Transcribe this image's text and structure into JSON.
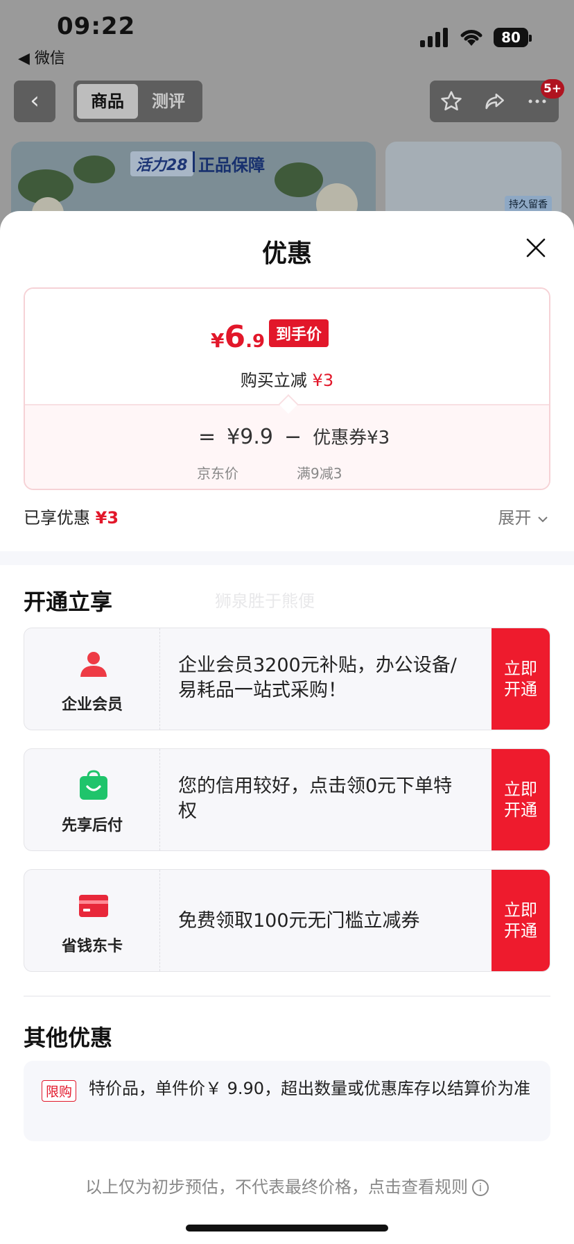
{
  "status_bar": {
    "time": "09:22",
    "back_app": "◀ 微信",
    "battery": "80"
  },
  "nav": {
    "tabs": [
      {
        "label": "商品",
        "active": true
      },
      {
        "label": "测评",
        "active": false
      }
    ],
    "badge": "5+"
  },
  "banner": {
    "logo": "活力28",
    "text": "正品保障",
    "tag": "持久留香"
  },
  "sheet": {
    "title": "优惠",
    "price_card": {
      "currency": "¥",
      "final_int": "6",
      "final_dec": ".9",
      "tag": "到手价",
      "reduce_label": "购买立减",
      "reduce_value": "¥3",
      "equation": {
        "eq": "=",
        "jd_price": "¥9.9",
        "minus": "−",
        "coupon": "优惠券¥3"
      },
      "jd_label": "京东价",
      "coupon_label": "满9减3"
    },
    "enjoyed_label": "已享优惠",
    "enjoyed_value": "¥3",
    "expand_label": "展开"
  },
  "open_section": {
    "title": "开通立享",
    "watermark": "狮泉胜于熊便",
    "offers": [
      {
        "name": "企业会员",
        "icon": "person-icon",
        "desc": "企业会员3200元补贴，办公设备/易耗品一站式采购！",
        "button": "立即开通"
      },
      {
        "name": "先享后付",
        "icon": "shopping-bag-icon",
        "desc": "您的信用较好，点击领0元下单特权",
        "button": "立即开通"
      },
      {
        "name": "省钱东卡",
        "icon": "card-icon",
        "desc": "免费领取100元无门槛立减券",
        "button": "立即开通"
      }
    ]
  },
  "other_section": {
    "title": "其他优惠",
    "tag": "限购",
    "text": "特价品，单件价￥ 9.90，超出数量或优惠库存以结算价为准"
  },
  "footnote": "以上仅为初步预估，不代表最终价格，点击查看规则",
  "colors": {
    "accent_red": "#e2172a",
    "button_red": "#ee1b2d",
    "member_green": "#1fc46b"
  }
}
